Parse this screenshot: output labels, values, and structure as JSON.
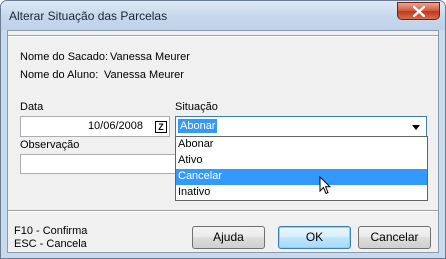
{
  "window": {
    "title": "Alterar Situação das Parcelas"
  },
  "info": {
    "sacado_label": "Nome do Sacado:",
    "sacado_value": "Vanessa Meurer",
    "aluno_label": "Nome do Aluno:",
    "aluno_value": "Vanessa Meurer"
  },
  "form": {
    "data_label": "Data",
    "data_value": "10/06/2008",
    "calendar_glyph": "Z",
    "situacao_label": "Situação",
    "situacao_value": "Abonar",
    "situacao_options": [
      "Abonar",
      "Ativo",
      "Cancelar",
      "Inativo"
    ],
    "situacao_highlighted": "Cancelar",
    "observacao_label": "Observação",
    "observacao_value": ""
  },
  "footer": {
    "hint_f10": "F10 - Confirma",
    "hint_esc": "ESC - Cancela",
    "ajuda_label": "Ajuda",
    "ok_label": "OK",
    "cancelar_label": "Cancelar"
  },
  "icons": {
    "close": "close-icon",
    "calendar": "calendar-icon",
    "dropdown": "chevron-down-icon",
    "cursor": "mouse-pointer-icon"
  },
  "colors": {
    "selection": "#3399ff",
    "titlebar": "#c7d8ec",
    "close": "#c0381b"
  }
}
